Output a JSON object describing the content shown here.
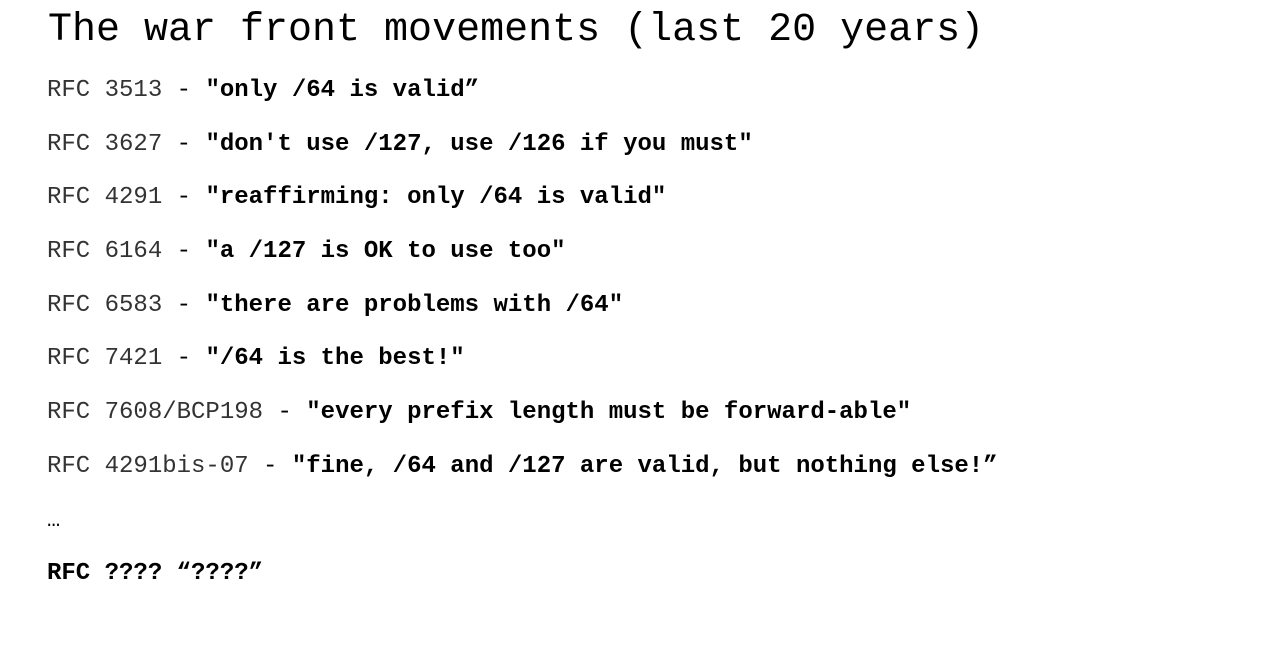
{
  "slide": {
    "title": "The war front movements (last 20 years)",
    "items": [
      {
        "rfc": "RFC 3513",
        "sep": " - ",
        "quote": "\"only /64 is valid”"
      },
      {
        "rfc": "RFC 3627",
        "sep": " - ",
        "quote": "\"don't use /127, use /126 if you must\""
      },
      {
        "rfc": "RFC 4291",
        "sep": " - ",
        "quote": "\"reaffirming: only /64 is valid\""
      },
      {
        "rfc": "RFC 6164",
        "sep": " - ",
        "quote": "\"a /127 is OK to use too\""
      },
      {
        "rfc": "RFC 6583",
        "sep": " - ",
        "quote": "\"there are problems with /64\""
      },
      {
        "rfc": "RFC 7421",
        "sep": " - ",
        "quote": "\"/64 is the best!\""
      },
      {
        "rfc": "RFC 7608/BCP198",
        "sep": " - ",
        "quote": "\"every prefix length must be forward-able\""
      },
      {
        "rfc": "RFC 4291bis-07",
        "sep": " - ",
        "quote": "\"fine, /64 and /127 are valid, but nothing else!”"
      }
    ],
    "ellipsis": "…",
    "final": "RFC ???? “????”"
  }
}
